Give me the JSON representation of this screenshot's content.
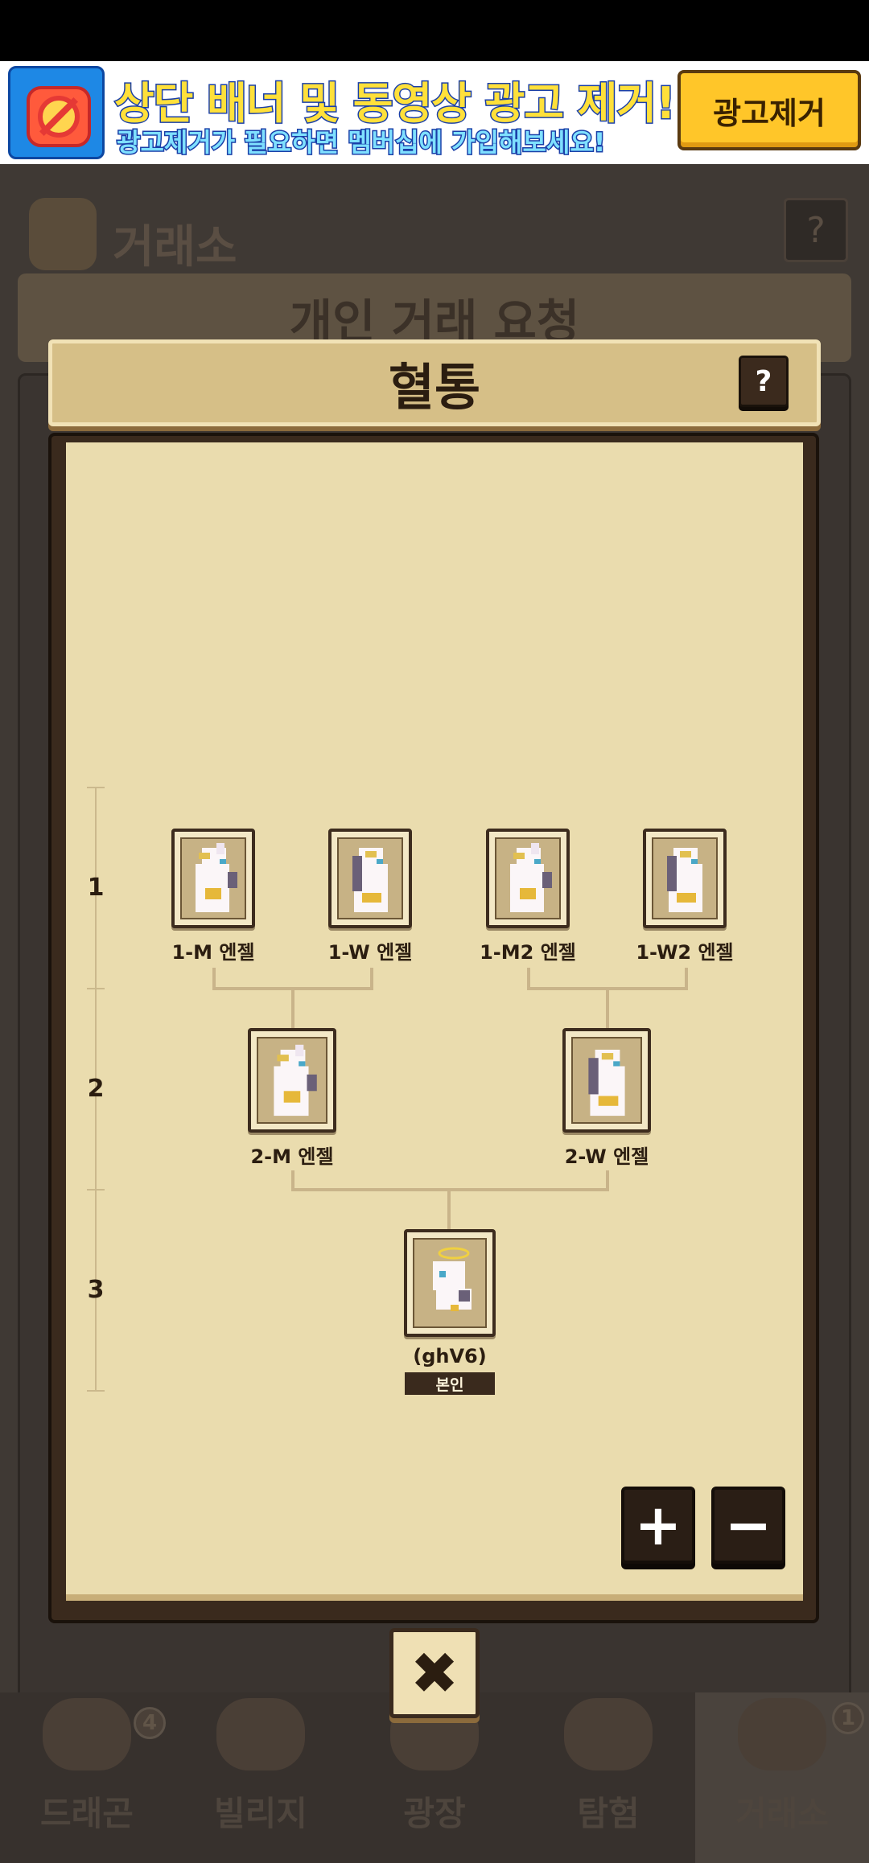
{
  "ad_banner": {
    "title": "상단 배너 및 동영상 광고 제거!",
    "subtitle": "광고제거가 필요하면 멤버십에 가입해보세요!",
    "remove_button": "광고제거"
  },
  "background_app": {
    "title": "거래소",
    "help": "?",
    "request_bar": "개인 거래 요청",
    "nav": [
      {
        "label": "드래곤",
        "badge": "4"
      },
      {
        "label": "빌리지",
        "badge": ""
      },
      {
        "label": "광장",
        "badge": ""
      },
      {
        "label": "탐험",
        "badge": ""
      },
      {
        "label": "거래소",
        "badge": "1"
      }
    ]
  },
  "modal": {
    "title": "혈통",
    "help": "?",
    "generations": [
      "1",
      "2",
      "3"
    ],
    "tree": {
      "gen1": [
        {
          "label": "1-M 엔젤"
        },
        {
          "label": "1-W 엔젤"
        },
        {
          "label": "1-M2 엔젤"
        },
        {
          "label": "1-W2 엔젤"
        }
      ],
      "gen2": [
        {
          "label": "2-M 엔젤"
        },
        {
          "label": "2-W 엔젤"
        }
      ],
      "self": {
        "label": "(ghV6)",
        "badge": "본인"
      }
    },
    "zoom_in": "+",
    "zoom_out": "−",
    "close": "✖"
  }
}
